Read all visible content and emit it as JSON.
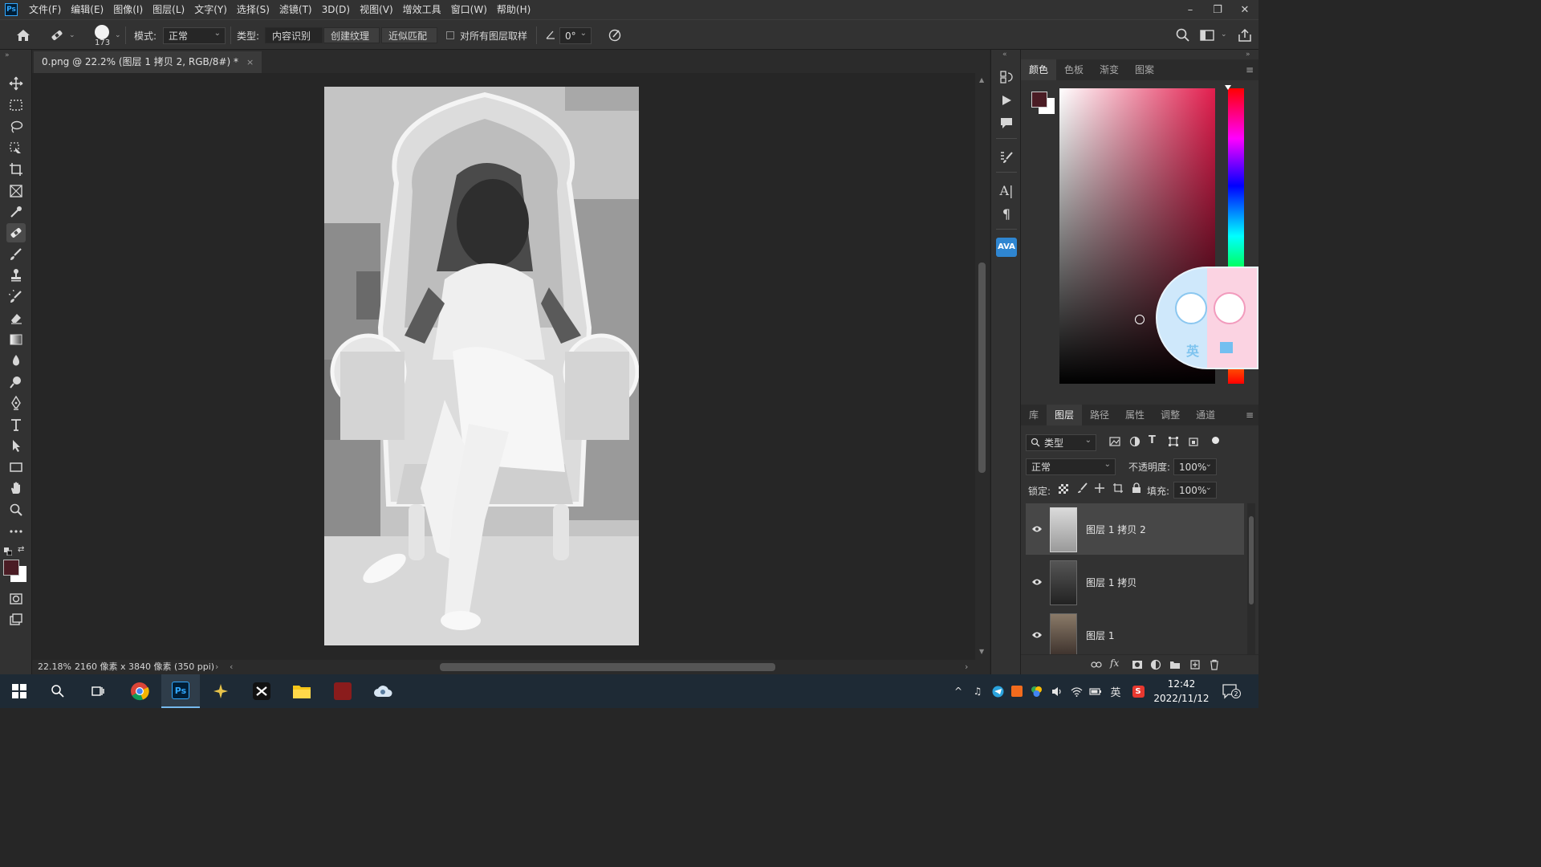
{
  "app": {
    "logo": "Ps"
  },
  "menu": [
    "文件(F)",
    "编辑(E)",
    "图像(I)",
    "图层(L)",
    "文字(Y)",
    "选择(S)",
    "滤镜(T)",
    "3D(D)",
    "视图(V)",
    "增效工具",
    "窗口(W)",
    "帮助(H)"
  ],
  "window_controls": {
    "minimize": "–",
    "restore": "❐",
    "close": "✕"
  },
  "options": {
    "brush_size": "173",
    "mode_label": "模式:",
    "mode_value": "正常",
    "type_label": "类型:",
    "type_buttons": [
      "内容识别",
      "创建纹理",
      "近似匹配"
    ],
    "sample_all_label": "对所有图层取样",
    "angle_value": "0°"
  },
  "document": {
    "tab_title": "0.png @ 22.2% (图层 1 拷贝 2, RGB/8#) *",
    "close_icon": "×"
  },
  "status": {
    "zoom": "22.18%",
    "doc_info": "2160 像素 x 3840 像素 (350 ppi)"
  },
  "color_panel": {
    "tabs": [
      "颜色",
      "色板",
      "渐变",
      "图案"
    ],
    "foreground": "#4a1c24",
    "background": "#ffffff"
  },
  "layers_panel": {
    "tabs": [
      "库",
      "图层",
      "路径",
      "属性",
      "调整",
      "通道"
    ],
    "filter_label": "类型",
    "blend_mode": "正常",
    "opacity_label": "不透明度:",
    "opacity_value": "100%",
    "lock_label": "锁定:",
    "fill_label": "填充:",
    "fill_value": "100%",
    "layers": [
      {
        "name": "图层 1 拷贝 2",
        "selected": true
      },
      {
        "name": "图层 1 拷贝",
        "selected": false
      },
      {
        "name": "图层 1",
        "selected": false
      }
    ]
  },
  "ime_badge": {
    "label": "英"
  },
  "taskbar": {
    "ime": "英",
    "time": "12:42",
    "date": "2022/11/12",
    "notification_count": "2"
  }
}
